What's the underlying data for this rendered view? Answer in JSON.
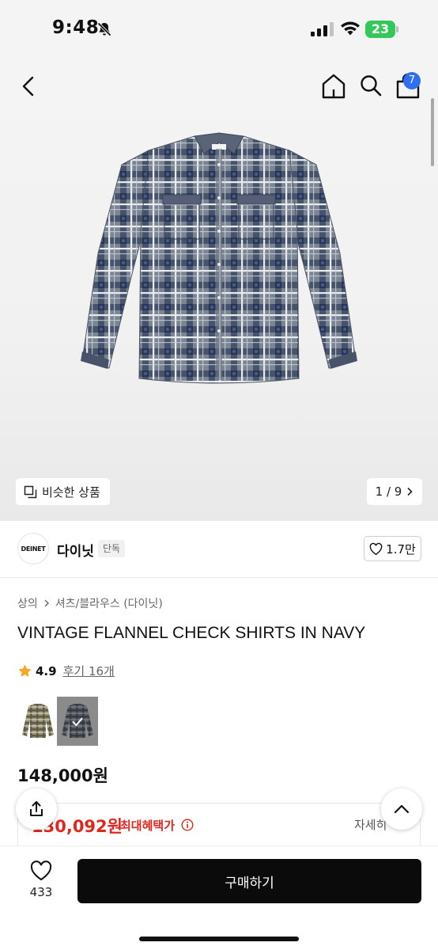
{
  "status_bar": {
    "time": "9:48",
    "battery": "23"
  },
  "header": {
    "cart_count": "7"
  },
  "gallery": {
    "similar_label": "비슷한 상품",
    "page_indicator": "1 / 9"
  },
  "brand": {
    "logo_text": "DEINET",
    "name": "다이닛",
    "tag": "단독",
    "likes": "1.7만"
  },
  "product": {
    "breadcrumb": [
      "상의",
      "셔츠/블라우스 (다이닛)"
    ],
    "title": "VINTAGE FLANNEL CHECK SHIRTS IN NAVY",
    "rating": "4.9",
    "review_link": "후기 16개",
    "price": "148,000원",
    "benefit_price": "130,092원",
    "benefit_label": "최대혜택가",
    "detail_link": "자세히"
  },
  "bottom_bar": {
    "wishlist_count": "433",
    "buy_label": "구매하기"
  },
  "colors": {
    "accent_blue": "#2f6ff2",
    "benefit_red": "#e0261d",
    "buy_button": "#0b0b0b",
    "star": "#f5a623",
    "battery_green": "#34c759"
  },
  "icons": [
    "bell-slash-icon",
    "signal-icon",
    "wifi-icon",
    "battery-icon",
    "back-icon",
    "home-icon",
    "search-icon",
    "cart-icon",
    "similar-icon",
    "chevron-right-icon",
    "heart-icon",
    "star-icon",
    "check-icon",
    "info-icon",
    "share-icon",
    "chevron-up-icon"
  ]
}
